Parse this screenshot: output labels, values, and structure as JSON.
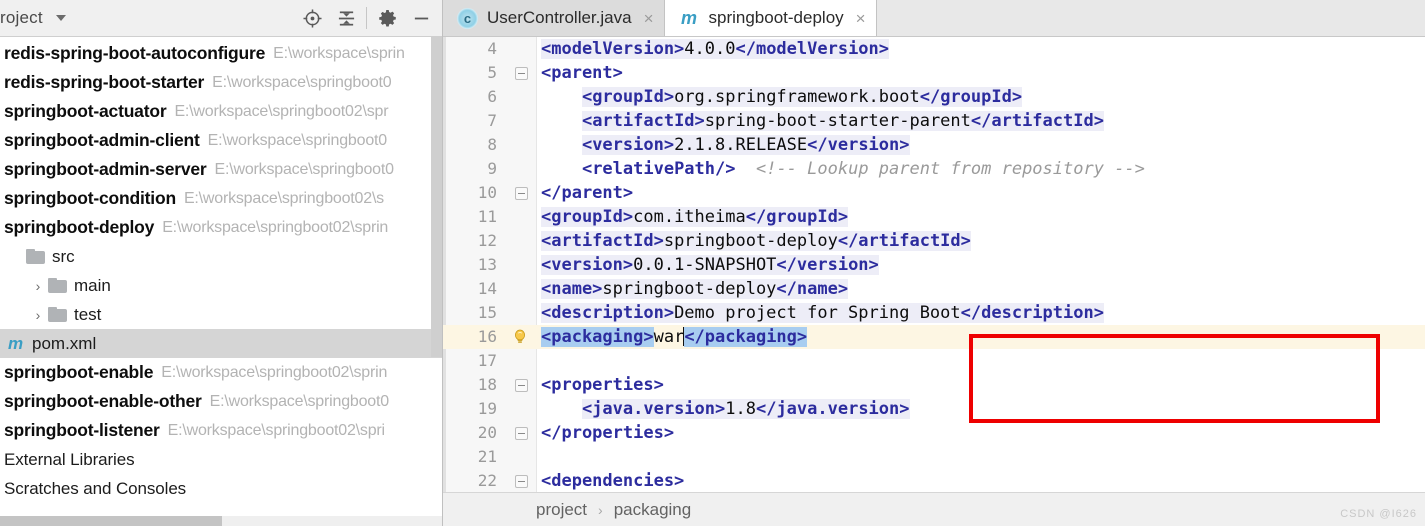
{
  "project_panel": {
    "title": "roject",
    "dropdown_icon": "chevron-down-icon",
    "toolbar_buttons": [
      {
        "name": "locate-icon",
        "label": "Select Opened File"
      },
      {
        "name": "collapse-all-icon",
        "label": "Collapse All"
      },
      {
        "name": "gear-icon",
        "label": "Settings"
      },
      {
        "name": "minimize-icon",
        "label": "Hide"
      }
    ],
    "tree": [
      {
        "type": "module",
        "name": "redis-spring-boot-autoconfigure",
        "path": "E:\\workspace\\sprin",
        "selected": false
      },
      {
        "type": "module",
        "name": "redis-spring-boot-starter",
        "path": "E:\\workspace\\springboot0",
        "selected": false
      },
      {
        "type": "module",
        "name": "springboot-actuator",
        "path": "E:\\workspace\\springboot02\\spr",
        "selected": false
      },
      {
        "type": "module",
        "name": "springboot-admin-client",
        "path": "E:\\workspace\\springboot0",
        "selected": false
      },
      {
        "type": "module",
        "name": "springboot-admin-server",
        "path": "E:\\workspace\\springboot0",
        "selected": false
      },
      {
        "type": "module",
        "name": "springboot-condition",
        "path": "E:\\workspace\\springboot02\\s",
        "selected": false
      },
      {
        "type": "module",
        "name": "springboot-deploy",
        "path": "E:\\workspace\\springboot02\\sprin",
        "selected": false
      },
      {
        "type": "folder",
        "name": "src",
        "indent": 1,
        "arrow": "",
        "selected": false
      },
      {
        "type": "folder",
        "name": "main",
        "indent": 2,
        "arrow": "›",
        "selected": false
      },
      {
        "type": "folder",
        "name": "test",
        "indent": 2,
        "arrow": "›",
        "selected": false
      },
      {
        "type": "file",
        "name": "pom.xml",
        "indent": 1,
        "icon": "maven-icon",
        "selected": true
      },
      {
        "type": "module",
        "name": "springboot-enable",
        "path": "E:\\workspace\\springboot02\\sprin",
        "selected": false
      },
      {
        "type": "module",
        "name": "springboot-enable-other",
        "path": "E:\\workspace\\springboot0",
        "selected": false
      },
      {
        "type": "module",
        "name": "springboot-listener",
        "path": "E:\\workspace\\springboot02\\spri",
        "selected": false
      },
      {
        "type": "plain",
        "name": "External Libraries",
        "selected": false
      },
      {
        "type": "plain",
        "name": "Scratches and Consoles",
        "selected": false
      }
    ]
  },
  "editor": {
    "tabs": [
      {
        "label": "UserController.java",
        "icon": "java-class-icon",
        "icon_letter": "c",
        "active": false,
        "close": "×"
      },
      {
        "label": "springboot-deploy",
        "icon": "maven-icon",
        "icon_letter": "m",
        "active": true,
        "close": "×"
      }
    ],
    "breadcrumb": {
      "items": [
        "project",
        "packaging"
      ],
      "separator": "›"
    },
    "code_lines": [
      {
        "no": "4",
        "fold": false,
        "bulb": false,
        "current": false,
        "indent": 0,
        "segments": [
          {
            "t": "<modelVersion>",
            "c": "tag occur"
          },
          {
            "t": "4.0.0",
            "c": "txt occur"
          },
          {
            "t": "</modelVersion>",
            "c": "tag occur"
          }
        ]
      },
      {
        "no": "5",
        "fold": true,
        "bulb": false,
        "current": false,
        "indent": 0,
        "segments": [
          {
            "t": "<parent>",
            "c": "tag"
          }
        ]
      },
      {
        "no": "6",
        "fold": false,
        "bulb": false,
        "current": false,
        "indent": 4,
        "segments": [
          {
            "t": "<groupId>",
            "c": "tag occur"
          },
          {
            "t": "org.springframework.boot",
            "c": "txt occur"
          },
          {
            "t": "</groupId>",
            "c": "tag occur"
          }
        ]
      },
      {
        "no": "7",
        "fold": false,
        "bulb": false,
        "current": false,
        "indent": 4,
        "segments": [
          {
            "t": "<artifactId>",
            "c": "tag occur"
          },
          {
            "t": "spring-boot-starter-parent",
            "c": "txt occur"
          },
          {
            "t": "</artifactId>",
            "c": "tag occur"
          }
        ]
      },
      {
        "no": "8",
        "fold": false,
        "bulb": false,
        "current": false,
        "indent": 4,
        "segments": [
          {
            "t": "<version>",
            "c": "tag occur"
          },
          {
            "t": "2.1.8.RELEASE",
            "c": "txt occur"
          },
          {
            "t": "</version>",
            "c": "tag occur"
          }
        ]
      },
      {
        "no": "9",
        "fold": false,
        "bulb": false,
        "current": false,
        "indent": 4,
        "segments": [
          {
            "t": "<relativePath/>",
            "c": "tag"
          },
          {
            "t": "  ",
            "c": "txt"
          },
          {
            "t": "<!-- Lookup parent from repository -->",
            "c": "comment"
          }
        ]
      },
      {
        "no": "10",
        "fold": true,
        "bulb": false,
        "current": false,
        "indent": 0,
        "segments": [
          {
            "t": "</parent>",
            "c": "tag"
          }
        ]
      },
      {
        "no": "11",
        "fold": false,
        "bulb": false,
        "current": false,
        "indent": 0,
        "segments": [
          {
            "t": "<groupId>",
            "c": "tag occur"
          },
          {
            "t": "com.itheima",
            "c": "txt occur"
          },
          {
            "t": "</groupId>",
            "c": "tag occur"
          }
        ]
      },
      {
        "no": "12",
        "fold": false,
        "bulb": false,
        "current": false,
        "indent": 0,
        "segments": [
          {
            "t": "<artifactId>",
            "c": "tag occur"
          },
          {
            "t": "springboot-deploy",
            "c": "txt occur"
          },
          {
            "t": "</artifactId>",
            "c": "tag occur"
          }
        ]
      },
      {
        "no": "13",
        "fold": false,
        "bulb": false,
        "current": false,
        "indent": 0,
        "segments": [
          {
            "t": "<version>",
            "c": "tag occur"
          },
          {
            "t": "0.0.1-SNAPSHOT",
            "c": "txt occur"
          },
          {
            "t": "</version>",
            "c": "tag occur"
          }
        ]
      },
      {
        "no": "14",
        "fold": false,
        "bulb": false,
        "current": false,
        "indent": 0,
        "segments": [
          {
            "t": "<name>",
            "c": "tag occur"
          },
          {
            "t": "springboot-deploy",
            "c": "txt occur"
          },
          {
            "t": "</name>",
            "c": "tag occur"
          }
        ]
      },
      {
        "no": "15",
        "fold": false,
        "bulb": false,
        "current": false,
        "indent": 0,
        "segments": [
          {
            "t": "<description>",
            "c": "tag occur"
          },
          {
            "t": "Demo project for Spring Boot",
            "c": "txt occur"
          },
          {
            "t": "</description>",
            "c": "tag occur"
          }
        ]
      },
      {
        "no": "16",
        "fold": false,
        "bulb": true,
        "current": true,
        "indent": 0,
        "segments": [
          {
            "t": "<packaging>",
            "c": "tag sel"
          },
          {
            "t": "war",
            "c": "txt"
          },
          {
            "t": "|CARET|",
            "c": "caret"
          },
          {
            "t": "</packaging>",
            "c": "tag sel"
          }
        ]
      },
      {
        "no": "17",
        "fold": false,
        "bulb": false,
        "current": false,
        "indent": 0,
        "segments": []
      },
      {
        "no": "18",
        "fold": true,
        "bulb": false,
        "current": false,
        "indent": 0,
        "segments": [
          {
            "t": "<properties>",
            "c": "tag"
          }
        ]
      },
      {
        "no": "19",
        "fold": false,
        "bulb": false,
        "current": false,
        "indent": 4,
        "segments": [
          {
            "t": "<java.version>",
            "c": "tag occur"
          },
          {
            "t": "1.8",
            "c": "txt occur"
          },
          {
            "t": "</java.version>",
            "c": "tag occur"
          }
        ]
      },
      {
        "no": "20",
        "fold": true,
        "bulb": false,
        "current": false,
        "indent": 0,
        "segments": [
          {
            "t": "</properties>",
            "c": "tag"
          }
        ]
      },
      {
        "no": "21",
        "fold": false,
        "bulb": false,
        "current": false,
        "indent": 0,
        "segments": []
      },
      {
        "no": "22",
        "fold": true,
        "bulb": false,
        "current": false,
        "indent": 0,
        "segments": [
          {
            "t": "<dependencies>",
            "c": "tag"
          }
        ]
      }
    ]
  },
  "annotation": {
    "red_box_color": "#ee0000"
  },
  "watermark": "CSDN @I626",
  "colors": {
    "tag": "#2c2c9e",
    "text": "#0c0c0c",
    "comment": "#9a9a9a",
    "selection": "#a8cdf0",
    "current_line": "#fdf6e3",
    "accent_maven": "#3a9ec4"
  }
}
